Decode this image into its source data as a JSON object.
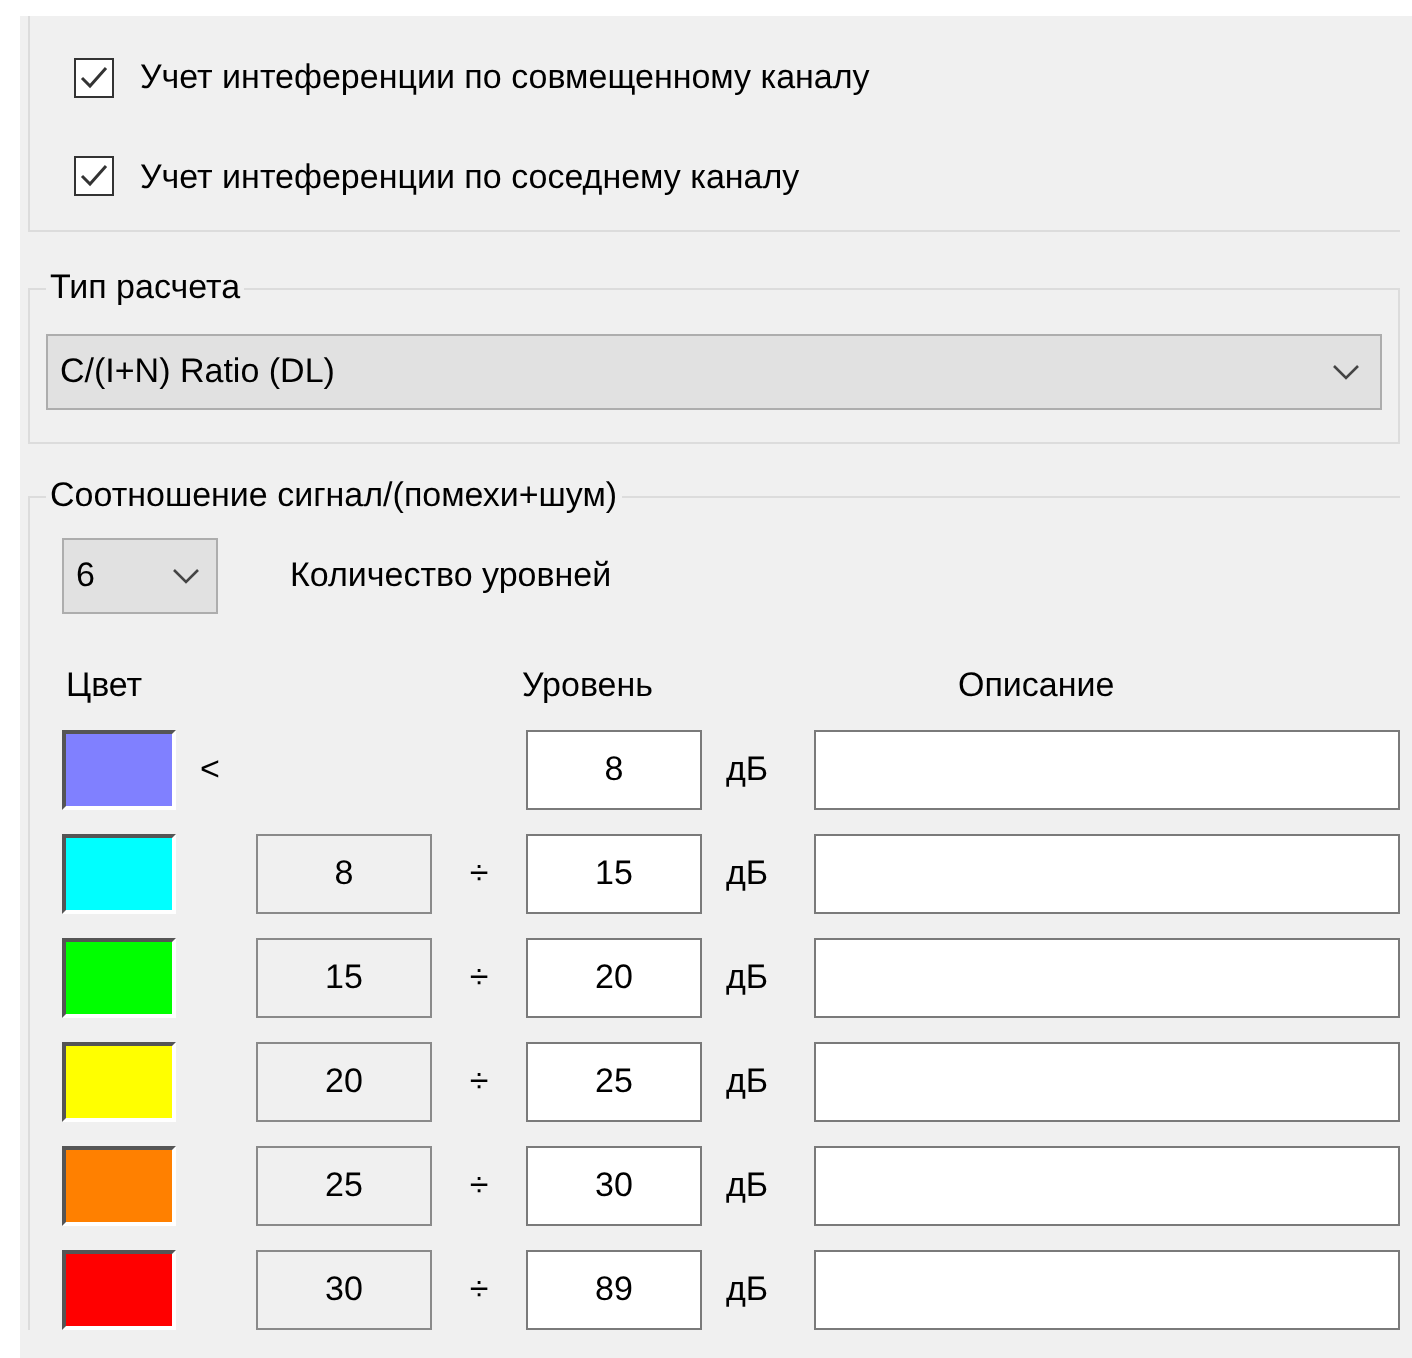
{
  "options": [
    {
      "label": "Учет интеференции по совмещенному каналу",
      "checked": true
    },
    {
      "label": "Учет интеференции по соседнему каналу",
      "checked": true
    }
  ],
  "calc_type": {
    "legend": "Тип расчета",
    "value": "C/(I+N) Ratio (DL)"
  },
  "ratio": {
    "legend": "Соотношение сигнал/(помехи+шум)",
    "levels_count": "6",
    "levels_label": "Количество уровней",
    "columns": [
      "Цвет",
      "Уровень",
      "Описание"
    ],
    "rows": [
      {
        "kind": "below",
        "color": "#8080ff",
        "sign": "<",
        "to": "8",
        "unit": "дБ"
      },
      {
        "kind": "range",
        "color": "#00ffff",
        "from": "8",
        "sign": "÷",
        "to": "15",
        "unit": "дБ"
      },
      {
        "kind": "range",
        "color": "#00ff00",
        "from": "15",
        "sign": "÷",
        "to": "20",
        "unit": "дБ"
      },
      {
        "kind": "range",
        "color": "#ffff00",
        "from": "20",
        "sign": "÷",
        "to": "25",
        "unit": "дБ"
      },
      {
        "kind": "range",
        "color": "#ff8000",
        "from": "25",
        "sign": "÷",
        "to": "30",
        "unit": "дБ"
      },
      {
        "kind": "range",
        "color": "#ff0000",
        "from": "30",
        "sign": "÷",
        "to": "89",
        "unit": "дБ"
      }
    ]
  }
}
